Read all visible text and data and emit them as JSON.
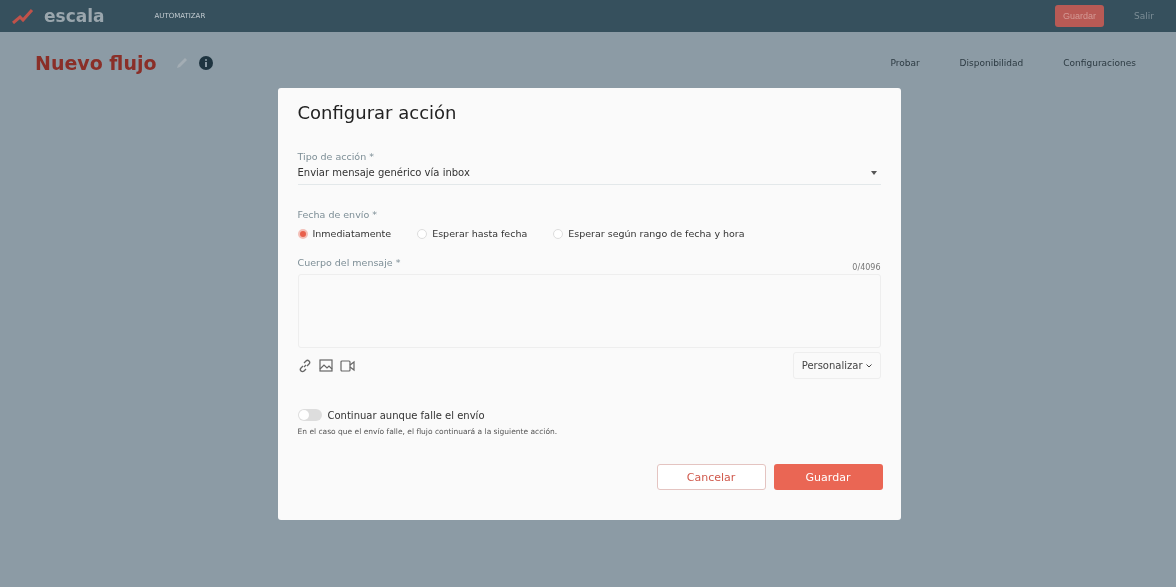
{
  "header": {
    "logo": "escala",
    "nav": "AUTOMATIZAR",
    "save_button": "Guardar",
    "exit_link": "Salir"
  },
  "page": {
    "title": "Nuevo flujo",
    "actions": [
      "Probar",
      "Disponibilidad",
      "Configuraciones"
    ]
  },
  "dialog": {
    "title": "Configurar acción",
    "action_type": {
      "label": "Tipo de acción *",
      "value": "Enviar mensaje genérico vía inbox"
    },
    "send_date": {
      "label": "Fecha de envío *",
      "options": [
        {
          "label": "Inmediatamente",
          "selected": true
        },
        {
          "label": "Esperar hasta fecha",
          "selected": false
        },
        {
          "label": "Esperar según rango de fecha y hora",
          "selected": false
        }
      ]
    },
    "message": {
      "label": "Cuerpo del mensaje *",
      "counter": "0/4096",
      "personalize": "Personalizar"
    },
    "continue_toggle": {
      "label": "Continuar aunque falle el envío",
      "on": false,
      "help": "En el caso que el envío falle, el flujo continuará a la siguiente acción."
    },
    "buttons": {
      "cancel": "Cancelar",
      "save": "Guardar"
    }
  }
}
